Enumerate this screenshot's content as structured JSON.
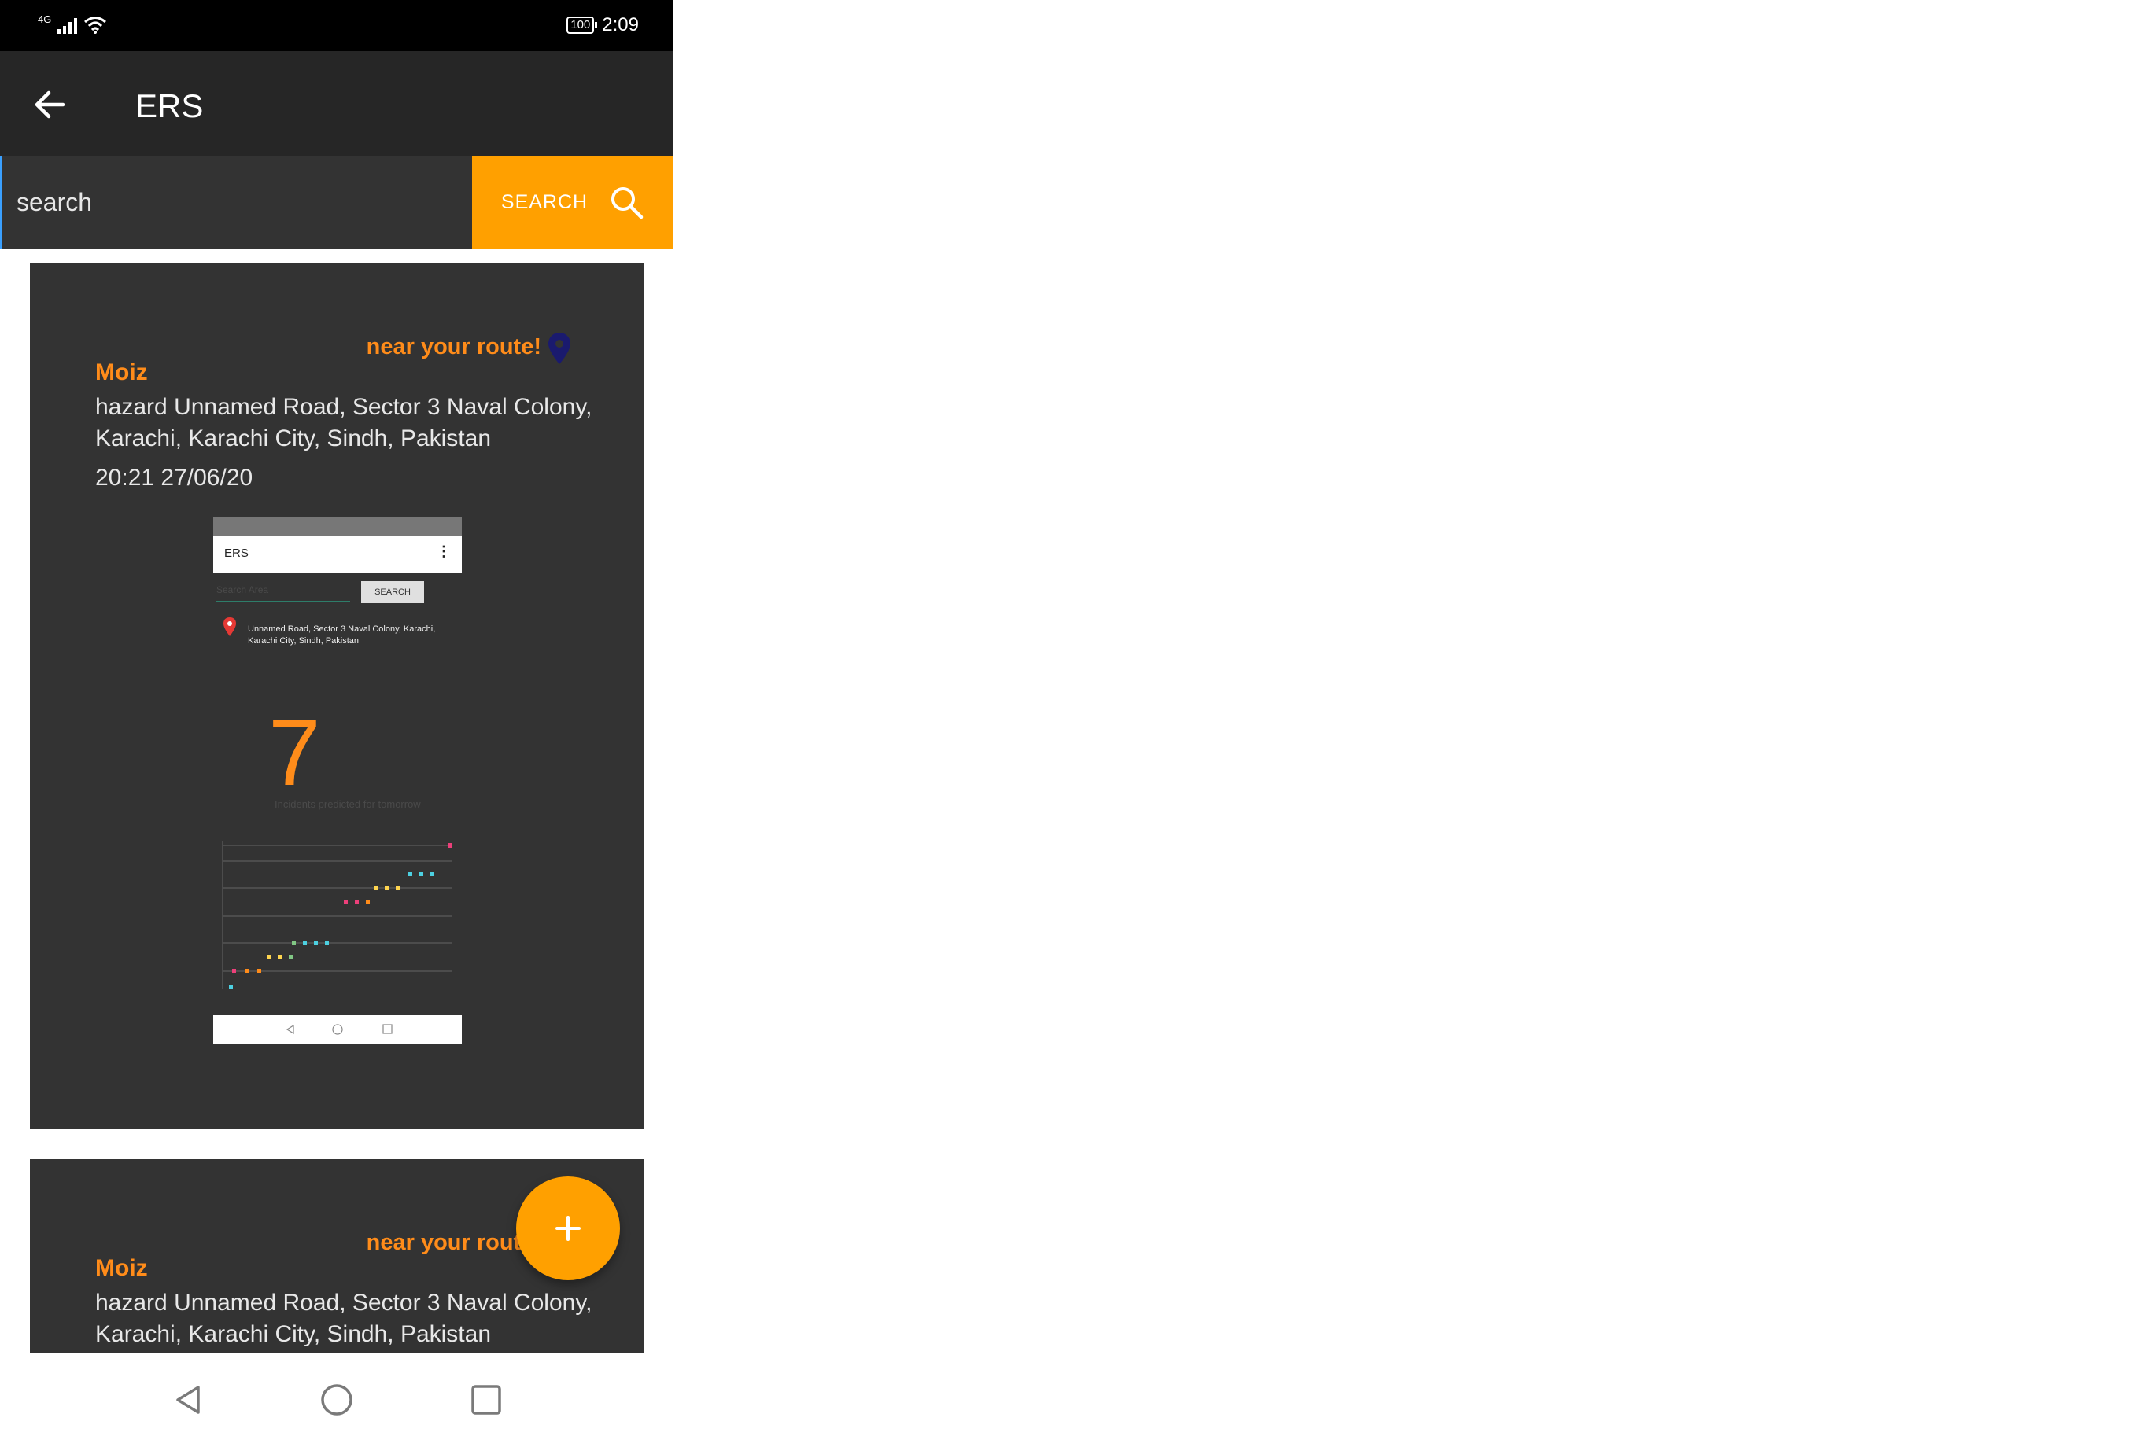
{
  "status_bar": {
    "network": "4G",
    "battery": "100",
    "time": "2:09"
  },
  "toolbar": {
    "title": "ERS"
  },
  "search": {
    "placeholder": "search",
    "button_label": "SEARCH"
  },
  "reports": [
    {
      "proximity": "near your route!",
      "user": "Moiz",
      "hazard": "hazard Unnamed Road, Sector 3 Naval Colony, Karachi, Karachi City, Sindh, Pakistan",
      "time": "20:21 27/06/20",
      "screenshot": {
        "title": "ERS",
        "search_placeholder": "Search Area",
        "search_button": "SEARCH",
        "address": "Unnamed Road, Sector 3 Naval Colony, Karachi, Karachi City, Sindh, Pakistan",
        "incident_count": "7",
        "caption": "Incidents predicted for tomorrow"
      }
    },
    {
      "proximity": "near your route!",
      "user": "Moiz",
      "hazard": "hazard Unnamed Road, Sector 3 Naval Colony, Karachi, Karachi City, Sindh, Pakistan"
    }
  ],
  "colors": {
    "accent": "#ffa000",
    "highlight_text": "#ff8c1a",
    "toolbar": "#262626",
    "card": "#333333",
    "pin": "#1a1a6e"
  }
}
